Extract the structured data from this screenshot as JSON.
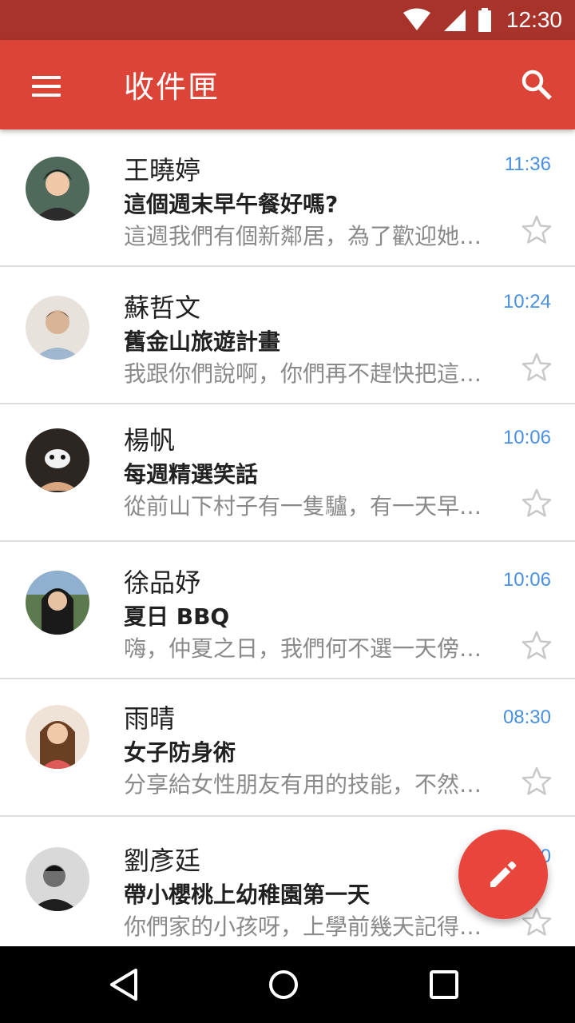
{
  "status_bar": {
    "time": "12:30"
  },
  "app_bar": {
    "title": "收件匣"
  },
  "emails": [
    {
      "sender": "王曉婷",
      "subject": "這個週末早午餐好嗎?",
      "preview": "這週我們有個新鄰居，為了歡迎她…",
      "time": "11:36",
      "avatar_color": "#4f6a5a"
    },
    {
      "sender": "蘇哲文",
      "subject": "舊金山旅遊計畫",
      "preview": "我跟你們說啊，你們再不趕快把這…",
      "time": "10:24",
      "avatar_color": "#d9c4b0"
    },
    {
      "sender": "楊帆",
      "subject": "每週精選笑話",
      "preview": "從前山下村子有一隻驢，有一天早…",
      "time": "10:06",
      "avatar_color": "#2b2622"
    },
    {
      "sender": "徐品妤",
      "subject": "夏日 BBQ",
      "preview": "嗨，仲夏之日，我們何不選一天傍…",
      "time": "10:06",
      "avatar_color": "#5d7a4e"
    },
    {
      "sender": "雨晴",
      "subject": "女子防身術",
      "preview": "分享給女性朋友有用的技能，不然…",
      "time": "08:30",
      "avatar_color": "#c98f6a"
    },
    {
      "sender": "劉彥廷",
      "subject": "帶小櫻桃上幼稚園第一天",
      "preview": "你們家的小孩呀，上學前幾天記得…",
      "time": "08:30",
      "avatar_color": "#3a3a3a"
    }
  ],
  "colors": {
    "status_bar": "#a8332b",
    "app_bar": "#dc4437",
    "time_text": "#4a90e2",
    "fab": "#e8453c"
  },
  "icons": {
    "menu": "menu-icon",
    "search": "search-icon",
    "star": "star-outline-icon",
    "compose": "pencil-icon"
  }
}
